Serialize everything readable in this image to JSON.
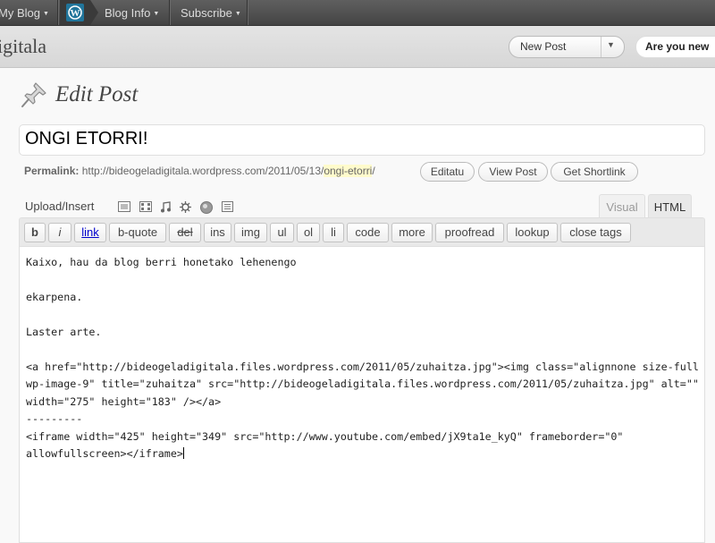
{
  "admin_bar": {
    "my_blog": "My Blog",
    "blog_info": "Blog Info",
    "subscribe": "Subscribe"
  },
  "header": {
    "site_name": "igitala",
    "new_post": "New Post",
    "are_you_new": "Are you new"
  },
  "page": {
    "title": "Edit Post"
  },
  "post": {
    "title": "ONGI ETORRI!",
    "permalink_label": "Permalink:",
    "permalink_base": "http://bideogeladigitala.wordpress.com/2011/05/13/",
    "permalink_slug": "ongi-etorri",
    "permalink_end": "/"
  },
  "permalink_buttons": {
    "edit": "Editatu",
    "view": "View Post",
    "shortlink": "Get Shortlink"
  },
  "media": {
    "label": "Upload/Insert",
    "icons": [
      "image-icon",
      "video-icon",
      "audio-icon",
      "media-icon",
      "poll-icon",
      "form-icon"
    ]
  },
  "editor_tabs": {
    "visual": "Visual",
    "html": "HTML",
    "active": "HTML"
  },
  "quicktags": [
    "b",
    "i",
    "link",
    "b-quote",
    "del",
    "ins",
    "img",
    "ul",
    "ol",
    "li",
    "code",
    "more",
    "proofread",
    "lookup",
    "close tags"
  ],
  "content_lines": [
    "Kaixo, hau da blog berri honetako lehenengo",
    "",
    "ekarpena.",
    "",
    "Laster arte.",
    "",
    "<a href=\"http://bideogeladigitala.files.wordpress.com/2011/05/zuhaitza.jpg\"><img class=\"alignnone size-full",
    "wp-image-9\" title=\"zuhaitza\" src=\"http://bideogeladigitala.files.wordpress.com/2011/05/zuhaitza.jpg\" alt=\"\"",
    "width=\"275\" height=\"183\" /></a>",
    "---------",
    "<iframe width=\"425\" height=\"349\" src=\"http://www.youtube.com/embed/jX9ta1e_kyQ\" frameborder=\"0\"",
    "allowfullscreen></iframe>"
  ],
  "colors": {
    "admin_bar": "#464646",
    "slug_highlight": "#fffbcc",
    "link": "#21759b"
  }
}
